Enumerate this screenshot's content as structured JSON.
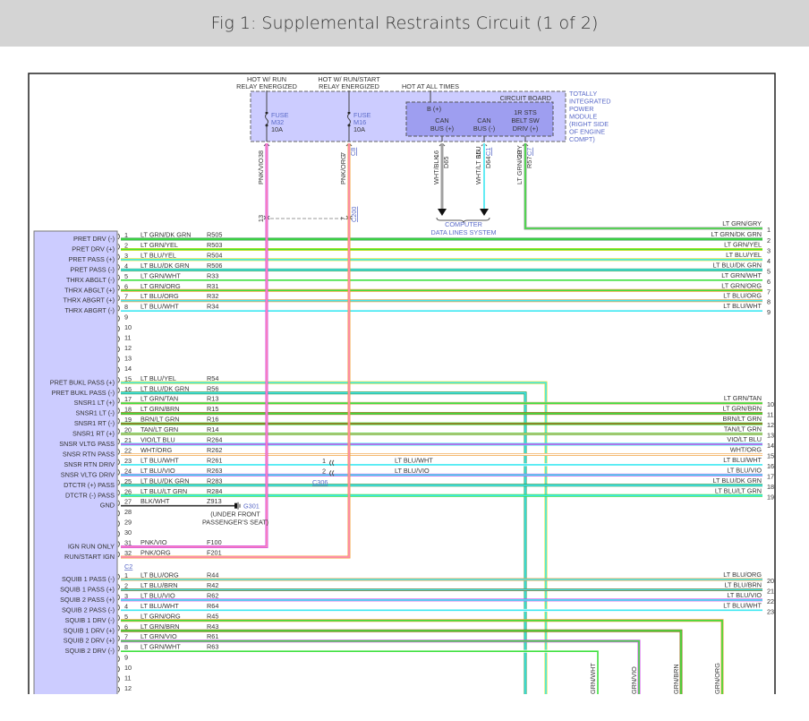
{
  "title": "Fig 1: Supplemental Restraints Circuit (1 of 2)",
  "palette": {
    "LT GRN": "#3fe03f",
    "LT BLU": "#3ee8f2",
    "YEL": "#e6e024",
    "DK GRN": "#2e9a4a",
    "WHT": "#ffffff",
    "ORG": "#f0a040",
    "BRN": "#9a7020",
    "TAN": "#d8b88c",
    "VIO": "#d050e8",
    "PNK": "#ff88b8",
    "BLK": "#333333",
    "GRY": "#a0a0a0",
    "module_fill": "#ccccff",
    "board_fill": "#9e9ef0",
    "frame": "#222222"
  },
  "tipm": {
    "supplies": [
      {
        "line1": "HOT W/ RUN",
        "line2": "RELAY ENERGIZED"
      },
      {
        "line1": "HOT W/ RUN/START",
        "line2": "RELAY ENERGIZED"
      },
      {
        "line1": "HOT AT ALL TIMES"
      }
    ],
    "fuses": [
      {
        "label": "FUSE",
        "id": "M32",
        "rating": "10A"
      },
      {
        "label": "FUSE",
        "id": "M16",
        "rating": "10A"
      }
    ],
    "circuit_board": "CIRCUIT BOARD",
    "b_plus": "B (+)",
    "outputs": [
      {
        "line1": "CAN",
        "line2": "BUS (+)"
      },
      {
        "line1": "CAN",
        "line2": "BUS (-)"
      },
      {
        "line1": "1R STS",
        "line2": "BELT SW",
        "line3": "DRIV (+)"
      }
    ],
    "module_name": [
      "TOTALLY",
      "INTEGRATED",
      "POWER",
      "MODULE",
      "(RIGHT SIDE",
      "OF ENGINE",
      "COMPT)"
    ],
    "wires": [
      {
        "pin": "38",
        "color": "PNK/VIO",
        "circuit": "",
        "connector": ""
      },
      {
        "pin": "7",
        "color": "PNK/ORG",
        "circuit": "",
        "connector": "C8"
      },
      {
        "pin": "16",
        "color": "WHT/BLK",
        "circuit": "D65",
        "connector": ""
      },
      {
        "pin": "15",
        "color": "WHT/LT BLU",
        "circuit": "D64",
        "connector": "C1"
      },
      {
        "pin": "20",
        "color": "LT GRN/GRY",
        "circuit": "R57",
        "connector": "C7"
      }
    ],
    "inline_connector": {
      "pins": [
        "13",
        "7"
      ],
      "name": "C200"
    },
    "data_lines": [
      "COMPUTER",
      "DATA LINES SYSTEM"
    ]
  },
  "c1_rows": [
    {
      "pin": "1",
      "fn": "PRET DRV (-)",
      "wire": "LT GRN/DK GRN",
      "circuit": "R505",
      "right": "2"
    },
    {
      "pin": "2",
      "fn": "PRET DRV (+)",
      "wire": "LT GRN/YEL",
      "circuit": "R503",
      "right": "3"
    },
    {
      "pin": "3",
      "fn": "PRET PASS (+)",
      "wire": "LT BLU/YEL",
      "circuit": "R504",
      "right": "4"
    },
    {
      "pin": "4",
      "fn": "PRET PASS (-)",
      "wire": "LT BLU/DK GRN",
      "circuit": "R506",
      "right": "5"
    },
    {
      "pin": "5",
      "fn": "THRX ABGLT (-)",
      "wire": "LT GRN/WHT",
      "circuit": "R33",
      "right": "6"
    },
    {
      "pin": "6",
      "fn": "THRX ABGLT (+)",
      "wire": "LT GRN/ORG",
      "circuit": "R31",
      "right": "7"
    },
    {
      "pin": "7",
      "fn": "THRX ABGRT (+)",
      "wire": "LT BLU/ORG",
      "circuit": "R32",
      "right": "8"
    },
    {
      "pin": "8",
      "fn": "THRX ABGRT (-)",
      "wire": "LT BLU/WHT",
      "circuit": "R34",
      "right": "9"
    },
    {
      "pin": "9"
    },
    {
      "pin": "10"
    },
    {
      "pin": "11"
    },
    {
      "pin": "12"
    },
    {
      "pin": "13"
    },
    {
      "pin": "14"
    },
    {
      "pin": "15",
      "fn": "PRET BUKL PASS (+)",
      "wire": "LT BLU/YEL",
      "circuit": "R54",
      "down": "610"
    },
    {
      "pin": "16",
      "fn": "PRET BUKL PASS (-)",
      "wire": "LT BLU/DK GRN",
      "circuit": "R56",
      "down": "587"
    },
    {
      "pin": "17",
      "fn": "SNSR1 LT (+)",
      "wire": "LT GRN/TAN",
      "circuit": "R13",
      "right": "10"
    },
    {
      "pin": "18",
      "fn": "SNSR1 LT (-)",
      "wire": "LT GRN/BRN",
      "circuit": "R15",
      "right": "11"
    },
    {
      "pin": "19",
      "fn": "SNSR1 RT (-)",
      "wire": "BRN/LT GRN",
      "circuit": "R16",
      "right": "12"
    },
    {
      "pin": "20",
      "fn": "SNSR1 RT (+)",
      "wire": "TAN/LT GRN",
      "circuit": "R14",
      "right": "13"
    },
    {
      "pin": "21",
      "fn": "SNSR VLTG PASS",
      "wire": "VIO/LT BLU",
      "circuit": "R264",
      "right": "14"
    },
    {
      "pin": "22",
      "fn": "SNSR RTN PASS",
      "wire": "WHT/ORG",
      "circuit": "R262",
      "right": "15"
    },
    {
      "pin": "23",
      "fn": "SNSR RTN DRIV",
      "wire": "LT BLU/WHT",
      "circuit": "R261",
      "right": "16"
    },
    {
      "pin": "24",
      "fn": "SNSR VLTG DRIV",
      "wire": "LT BLU/VIO",
      "circuit": "R263",
      "right": "17"
    },
    {
      "pin": "25",
      "fn": "DTCTR (+) PASS",
      "wire": "LT BLU/DK GRN",
      "circuit": "R283",
      "right": "18"
    },
    {
      "pin": "26",
      "fn": "DTCTR (-) PASS",
      "wire": "LT BLU/LT GRN",
      "circuit": "R284",
      "right": "19"
    },
    {
      "pin": "27",
      "fn": "GND",
      "wire": "BLK/WHT",
      "circuit": "Z913",
      "ground": "G301"
    },
    {
      "pin": "28"
    },
    {
      "pin": "29"
    },
    {
      "pin": "30"
    },
    {
      "pin": "31",
      "fn": "IGN RUN ONLY",
      "wire": "PNK/VIO",
      "circuit": "F100",
      "up": "298"
    },
    {
      "pin": "32",
      "fn": "RUN/START IGN",
      "wire": "PNK/ORG",
      "circuit": "F201",
      "up": "390"
    }
  ],
  "c2_label": "C2",
  "c2_rows": [
    {
      "pin": "1",
      "fn": "SQUIB 1 PASS (-)",
      "wire": "LT BLU/ORG",
      "circuit": "R44",
      "right": "20"
    },
    {
      "pin": "2",
      "fn": "SQUIB 1 PASS (+)",
      "wire": "LT BLU/BRN",
      "circuit": "R42",
      "right": "21"
    },
    {
      "pin": "3",
      "fn": "SQUIB 2 PASS (+)",
      "wire": "LT BLU/VIO",
      "circuit": "R62",
      "right": "22"
    },
    {
      "pin": "4",
      "fn": "SQUIB 2 PASS (-)",
      "wire": "LT BLU/WHT",
      "circuit": "R64",
      "right": "23"
    },
    {
      "pin": "5",
      "fn": "SQUIB 1 DRV (-)",
      "wire": "LT GRN/ORG",
      "circuit": "R45",
      "down": "807",
      "down_label": "GRN/ORG"
    },
    {
      "pin": "6",
      "fn": "SQUIB 1 DRV (+)",
      "wire": "LT GRN/BRN",
      "circuit": "R43",
      "down": "761",
      "down_label": "GRN/BRN"
    },
    {
      "pin": "7",
      "fn": "SQUIB 2 DRV (+)",
      "wire": "LT GRN/VIO",
      "circuit": "R61",
      "down": "714",
      "down_label": "GRN/VIO"
    },
    {
      "pin": "8",
      "fn": "SQUIB 2 DRV (-)",
      "wire": "LT GRN/WHT",
      "circuit": "R63",
      "down": "668",
      "down_label": "GRN/WHT"
    },
    {
      "pin": "9"
    },
    {
      "pin": "10"
    },
    {
      "pin": "11"
    },
    {
      "pin": "12"
    }
  ],
  "right_top": {
    "pin": "1",
    "wire": "LT GRN/GRY"
  },
  "ground": {
    "name": "G301",
    "note1": "(UNDER FRONT",
    "note2": "PASSENGER'S SEAT)"
  },
  "c306": {
    "name": "C306",
    "pins": [
      "1",
      "2"
    ],
    "wires": [
      "LT BLU/WHT",
      "LT BLU/VIO"
    ]
  }
}
